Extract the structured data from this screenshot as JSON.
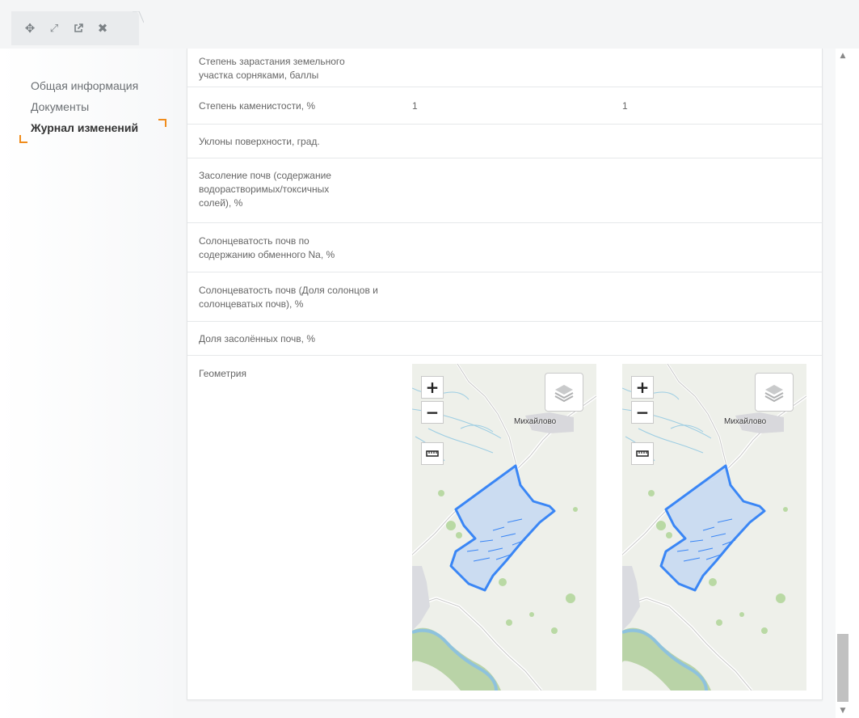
{
  "toolbar": {
    "move_icon": "move-icon",
    "expand_icon": "expand-icon",
    "external_icon": "external-link-icon",
    "close_icon": "close-icon"
  },
  "nav": {
    "items": [
      {
        "label": "Общая информация",
        "active": false
      },
      {
        "label": "Документы",
        "active": false
      },
      {
        "label": "Журнал изменений",
        "active": true
      }
    ],
    "accent_color": "#f08c1c"
  },
  "table": {
    "rows": [
      {
        "label": "Степень зарастания земельного участка сорняками, баллы",
        "v1": "",
        "v2": ""
      },
      {
        "label": "Степень каменистости, %",
        "v1": "1",
        "v2": "1"
      },
      {
        "label": "Уклоны поверхности, град.",
        "v1": "",
        "v2": ""
      },
      {
        "label": "Засоление почв (содержание водорастворимых/токсичных солей), %",
        "v1": "",
        "v2": ""
      },
      {
        "label": "Солонцеватость почв по содержанию обменного Na, %",
        "v1": "",
        "v2": ""
      },
      {
        "label": "Солонцеватость почв (Доля солонцов и солонцеватых почв), %",
        "v1": "",
        "v2": ""
      },
      {
        "label": "Доля засолённых почв, %",
        "v1": "",
        "v2": ""
      },
      {
        "label": "Геометрия",
        "v1": "",
        "v2": ""
      }
    ]
  },
  "maps": [
    {
      "zoom_in": "+",
      "zoom_out": "−",
      "place": "Михайлово",
      "ruler_icon": "ruler-icon",
      "layers_icon": "layers-icon"
    },
    {
      "zoom_in": "+",
      "zoom_out": "−",
      "place": "Михайлово",
      "ruler_icon": "ruler-icon",
      "layers_icon": "layers-icon"
    }
  ],
  "scrollbar": {
    "up": "▲",
    "down": "▼"
  },
  "colors": {
    "polygon_stroke": "#3a86f5",
    "polygon_fill": "#c4d8f2",
    "water": "#8ec2dd"
  }
}
